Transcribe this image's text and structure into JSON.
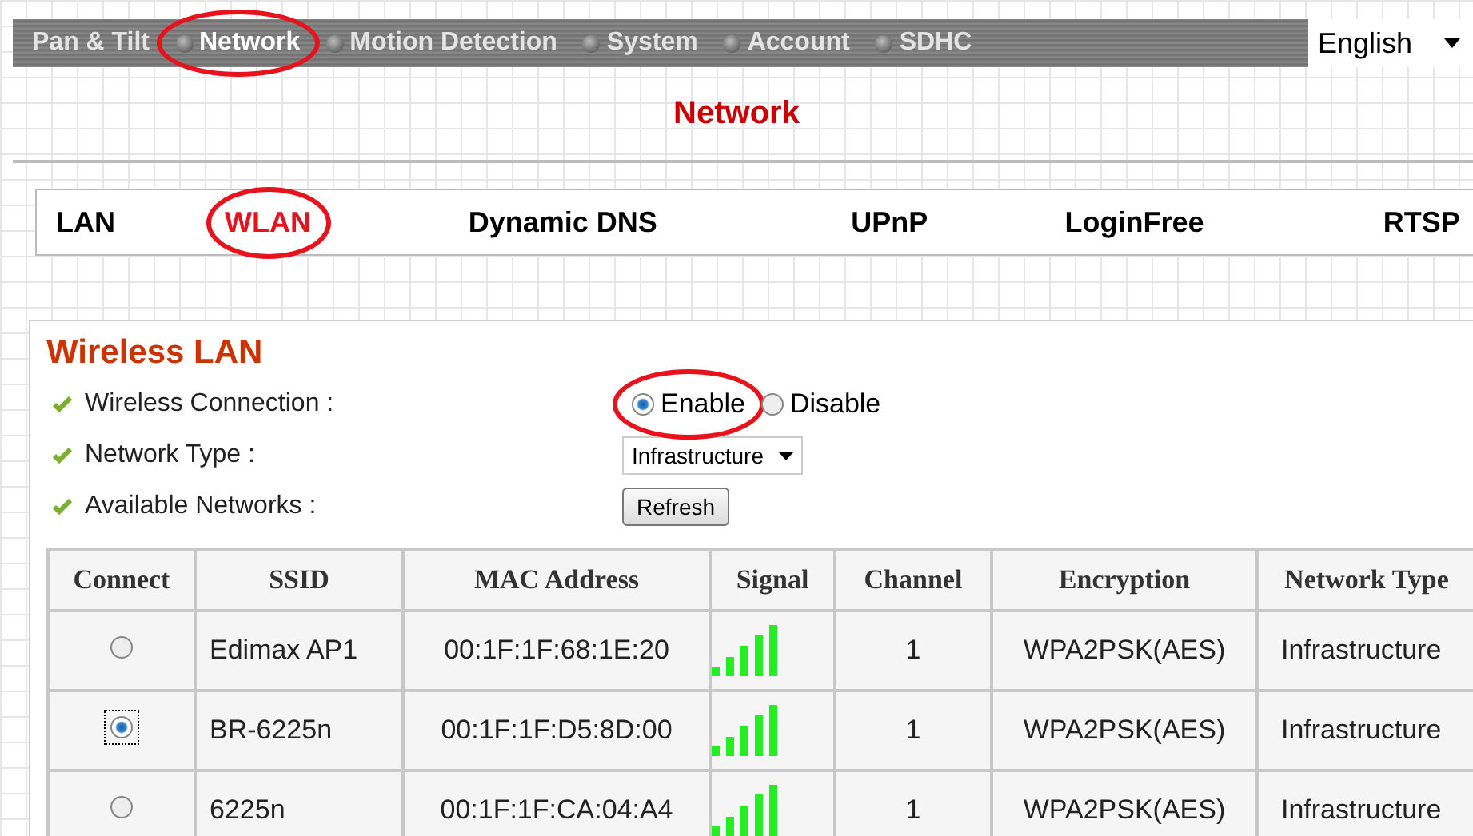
{
  "menu": [
    {
      "label": "Pan & Tilt",
      "selected": false,
      "highlighted": false
    },
    {
      "label": "Network",
      "selected": true,
      "highlighted": true
    },
    {
      "label": "Motion Detection",
      "selected": false,
      "highlighted": false
    },
    {
      "label": "System",
      "selected": false,
      "highlighted": false
    },
    {
      "label": "Account",
      "selected": false,
      "highlighted": false
    },
    {
      "label": "SDHC",
      "selected": false,
      "highlighted": false
    }
  ],
  "language": {
    "value": "English"
  },
  "page_title": "Network",
  "tabs": [
    {
      "label": "LAN",
      "selected": false,
      "highlighted": false
    },
    {
      "label": "WLAN",
      "selected": true,
      "highlighted": true
    },
    {
      "label": "Dynamic DNS",
      "selected": false,
      "highlighted": false
    },
    {
      "label": "UPnP",
      "selected": false,
      "highlighted": false
    },
    {
      "label": "LoginFree",
      "selected": false,
      "highlighted": false
    },
    {
      "label": "RTSP",
      "selected": false,
      "highlighted": false
    }
  ],
  "section_title": "Wireless LAN",
  "settings": [
    {
      "label": "Wireless Connection :",
      "kind": "radio",
      "options": [
        {
          "label": "Enable",
          "selected": true,
          "highlighted": true
        },
        {
          "label": "Disable",
          "selected": false,
          "highlighted": false
        }
      ]
    },
    {
      "label": "Network Type :",
      "kind": "select",
      "value": "Infrastructure"
    },
    {
      "label": "Available Networks :",
      "kind": "button",
      "button": "Refresh"
    }
  ],
  "table": {
    "columns": [
      "Connect",
      "SSID",
      "MAC Address",
      "Signal",
      "Channel",
      "Encryption",
      "Network Type"
    ],
    "rows": [
      {
        "selected": false,
        "ssid": "Edimax AP1",
        "mac": "00:1F:1F:68:1E:20",
        "channel": "1",
        "encryption": "WPA2PSK(AES)",
        "network_type": "Infrastructure"
      },
      {
        "selected": true,
        "ssid": "BR-6225n",
        "mac": "00:1F:1F:D5:8D:00",
        "channel": "1",
        "encryption": "WPA2PSK(AES)",
        "network_type": "Infrastructure"
      },
      {
        "selected": false,
        "ssid": "6225n",
        "mac": "00:1F:1F:CA:04:A4",
        "channel": "1",
        "encryption": "WPA2PSK(AES)",
        "network_type": "Infrastructure"
      }
    ]
  }
}
